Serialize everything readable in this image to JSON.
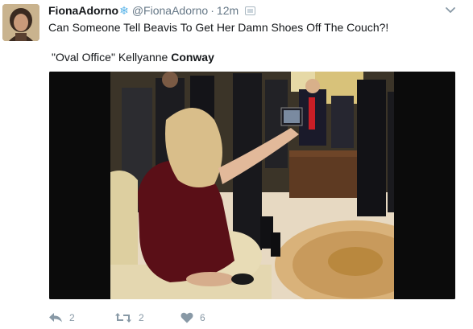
{
  "tweet": {
    "display_name": "FionaAdorno",
    "snowflake_icon": "snowflake-icon",
    "handle": "@FionaAdorno",
    "separator": "·",
    "time": "12m",
    "text_line1": "Can Someone Tell Beavis To Get Her Damn Shoes Off The Couch?!",
    "text_line2_part1": "\"Oval Office\" Kellyanne ",
    "text_line2_bold": "Conway"
  },
  "actions": {
    "reply_count": "2",
    "retweet_count": "2",
    "like_count": "6"
  },
  "colors": {
    "name": "#14171a",
    "meta": "#657786",
    "icon": "#8899a6",
    "snowflake": "#57b3e8"
  }
}
